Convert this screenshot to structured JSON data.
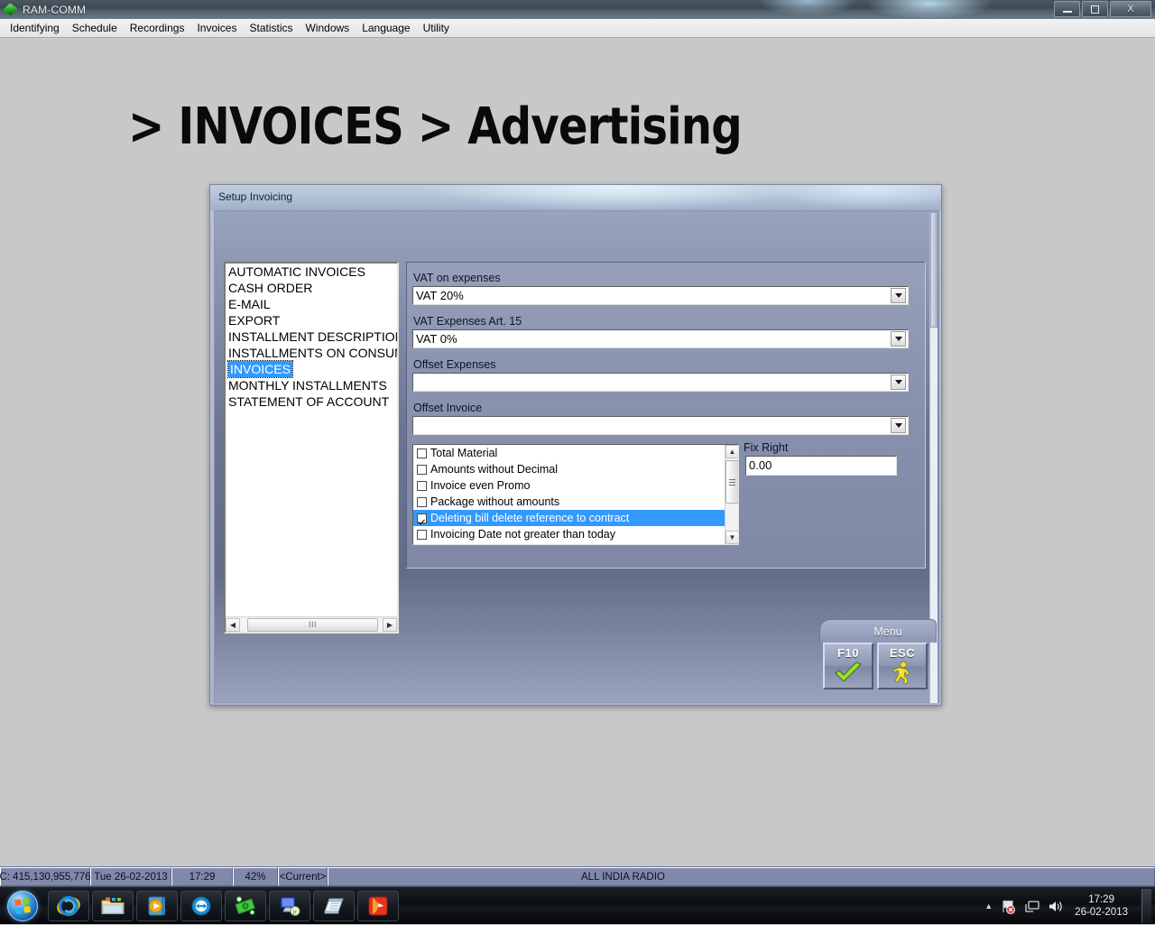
{
  "window": {
    "title": "RAM-COMM",
    "icon": "app-gem-icon",
    "controls": {
      "minimize": "minimize-icon",
      "maximize": "maximize-icon",
      "close": "X"
    }
  },
  "menubar": {
    "items": [
      {
        "label": "Identifying"
      },
      {
        "label": "Schedule"
      },
      {
        "label": "Recordings"
      },
      {
        "label": "Invoices"
      },
      {
        "label": "Statistics"
      },
      {
        "label": "Windows"
      },
      {
        "label": "Language"
      },
      {
        "label": "Utility"
      }
    ]
  },
  "page": {
    "heading": "> INVOICES > Advertising"
  },
  "dialog": {
    "title": "Setup Invoicing",
    "categories": [
      {
        "label": "AUTOMATIC INVOICES",
        "selected": false
      },
      {
        "label": "CASH ORDER",
        "selected": false
      },
      {
        "label": "E-MAIL",
        "selected": false
      },
      {
        "label": "EXPORT",
        "selected": false
      },
      {
        "label": "INSTALLMENT DESCRIPTION",
        "selected": false
      },
      {
        "label": "INSTALLMENTS ON CONSUM",
        "selected": false
      },
      {
        "label": "INVOICES",
        "selected": true
      },
      {
        "label": "MONTHLY INSTALLMENTS",
        "selected": false
      },
      {
        "label": "STATEMENT OF ACCOUNT",
        "selected": false
      }
    ],
    "fields": [
      {
        "label": "VAT on expenses",
        "value": "VAT 20%"
      },
      {
        "label": "VAT Expenses Art. 15",
        "value": "VAT 0%"
      },
      {
        "label": "Offset Expenses",
        "value": ""
      },
      {
        "label": "Offset Invoice",
        "value": ""
      }
    ],
    "options": [
      {
        "label": "Total Material",
        "checked": false,
        "selected": false
      },
      {
        "label": "Amounts without Decimal",
        "checked": false,
        "selected": false
      },
      {
        "label": "Invoice even Promo",
        "checked": false,
        "selected": false
      },
      {
        "label": "Package without amounts",
        "checked": false,
        "selected": false
      },
      {
        "label": "Deleting bill delete reference to contract",
        "checked": true,
        "selected": true
      },
      {
        "label": "Invoicing Date not greater than today",
        "checked": false,
        "selected": false
      }
    ],
    "fix_right": {
      "label": "Fix Right",
      "value": "0.00"
    },
    "menu_tab": {
      "label": "Menu"
    },
    "buttons": [
      {
        "key": "F10",
        "icon": "green-check-icon",
        "name": "confirm"
      },
      {
        "key": "ESC",
        "icon": "yellow-runner-exit-icon",
        "name": "exit"
      }
    ]
  },
  "statusbar": {
    "disk": "C: 415,130,955,776",
    "date": "Tue 26-02-2013",
    "time": "17:29",
    "zoom": "42%",
    "user": "<Current>",
    "station": "ALL INDIA RADIO"
  },
  "taskbar": {
    "start": "start-orb-icon",
    "quick_launch": [
      {
        "icon": "internet-explorer-icon"
      },
      {
        "icon": "windows-explorer-folder-icon"
      },
      {
        "icon": "media-player-icon"
      },
      {
        "icon": "teamviewer-icon"
      },
      {
        "icon": "money-cash-icon"
      },
      {
        "icon": "remote-desktop-jr-icon"
      },
      {
        "icon": "notepad-icon"
      },
      {
        "icon": "red-face-app-icon"
      }
    ],
    "tray": [
      {
        "icon": "show-hidden-icons-arrow"
      },
      {
        "icon": "action-center-flag-error-icon"
      },
      {
        "icon": "network-icon"
      },
      {
        "icon": "volume-speaker-icon"
      }
    ],
    "clock_time": "17:29",
    "clock_date": "26-02-2013"
  },
  "colors": {
    "accent_selection": "#3399ff",
    "dialog_body": "#6a7390",
    "statusbar": "#8089ac",
    "desktop": "#c8c8c8",
    "check_green": "#9ede3a",
    "runner_yellow": "#f2e03a"
  }
}
